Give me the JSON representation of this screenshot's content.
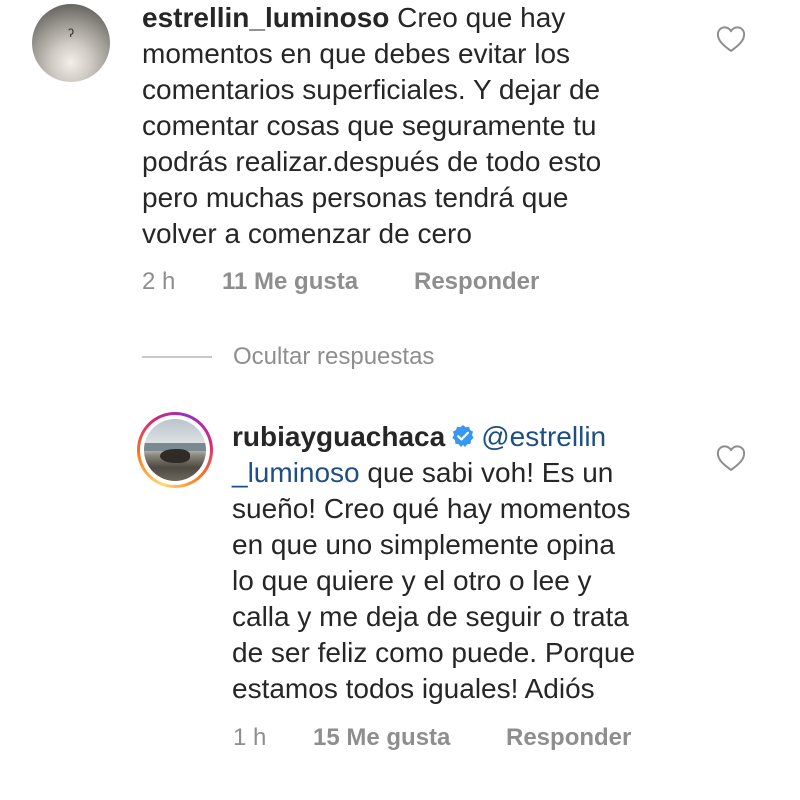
{
  "comments": [
    {
      "username": "estrellin_luminoso",
      "text_lines": [
        " Creo que hay",
        "momentos en que debes evitar los",
        "comentarios superficiales. Y dejar de",
        "comentar cosas que seguramente tu",
        "podrás realizar.después de todo esto",
        "pero muchas personas tendrá que",
        "volver a comenzar de cero"
      ],
      "time": "2 h",
      "likes": "11 Me gusta",
      "reply_label": "Responder",
      "avatar_icon": "user-avatar",
      "like_icon": "heart-outline-icon"
    }
  ],
  "replies_toggle": {
    "label": "Ocultar respuestas"
  },
  "reply": {
    "username": "rubiayguachaca",
    "verified_icon": "verified-badge-icon",
    "mention_part1": "@estrellin",
    "mention_part2": "_luminoso",
    "text_lines": [
      " que sabi voh! Es un",
      "sueño! Creo qué hay momentos",
      "en que uno simplemente opina",
      "lo que quiere y el otro o lee y",
      "calla y me deja de seguir o trata",
      "de ser feliz como puede. Porque",
      "estamos todos iguales! Adiós"
    ],
    "time": "1 h",
    "likes": "15 Me gusta",
    "reply_label": "Responder",
    "like_icon": "heart-outline-icon"
  },
  "colors": {
    "text": "#262626",
    "secondary": "#8e8e8e",
    "mention": "#1e4f82",
    "verified": "#3897f0",
    "divider": "#c7c7c7"
  }
}
